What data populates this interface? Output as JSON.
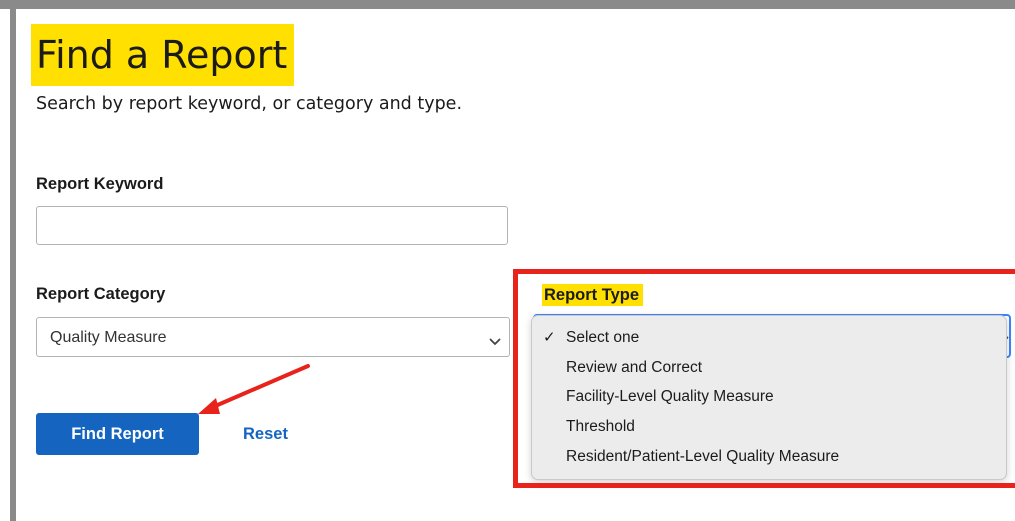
{
  "page": {
    "title": "Find a Report",
    "subtitle": "Search by report keyword, or category and type."
  },
  "form": {
    "keyword": {
      "label": "Report Keyword",
      "value": "",
      "placeholder": ""
    },
    "category": {
      "label": "Report Category",
      "selected": "Quality Measure"
    },
    "type": {
      "label": "Report Type",
      "options": [
        {
          "label": "Select one",
          "checked": true
        },
        {
          "label": "Review and Correct",
          "checked": false
        },
        {
          "label": "Facility-Level Quality Measure",
          "checked": false
        },
        {
          "label": "Threshold",
          "checked": false
        },
        {
          "label": "Resident/Patient-Level Quality Measure",
          "checked": false
        }
      ]
    },
    "actions": {
      "find_label": "Find Report",
      "reset_label": "Reset"
    }
  },
  "icons": {
    "checkmark": "✓",
    "dropdown": "chevron-down-icon",
    "annotation_arrow": "red-arrow-icon"
  },
  "colors": {
    "highlight_yellow": "#ffe000",
    "annotation_red": "#e8231b",
    "primary_blue": "#1565c0",
    "focus_blue": "#3a86ff",
    "frame_gray": "#8a8a8a"
  }
}
